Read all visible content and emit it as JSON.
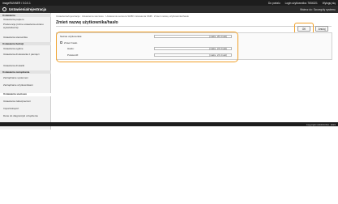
{
  "topbar": {
    "device": "imageRUNNER / 0.0.0.1",
    "links": [
      "Do portalu",
      "Login użytkownika: 7654321",
      "Wyloguj się"
    ]
  },
  "titlebar": {
    "title": "Ustawienia/rejestracja",
    "portal_link": "Wstecz do: Szczegóły systemu"
  },
  "sidebar": {
    "items": [
      {
        "label": "Ustawienia",
        "section": true
      },
      {
        "label": "Ustawienia papieru"
      },
      {
        "label": "Preferencje (różne ustawienia ekranu wyświetlacza)"
      },
      {
        "label": "Ustawienia sterownika"
      },
      {
        "label": "Ustawienia funkcji",
        "section": true
      },
      {
        "label": "Ustawienia ogólne"
      },
      {
        "label": "Ustawienia drukowania z pamięci"
      },
      {
        "label": "Ustawienia drukarki"
      },
      {
        "label": "Ustawienia zarządzania",
        "section": true
      },
      {
        "label": "Zarządzanie systemem"
      },
      {
        "label": "Zarządzanie użytkownikami"
      },
      {
        "label": "Ustawienia sieciowe",
        "active": true
      },
      {
        "label": "Ustawienia zabezpieczeń"
      },
      {
        "label": "Import/eksport"
      },
      {
        "label": "Dane do diagnostyki urządzenia"
      }
    ]
  },
  "main": {
    "breadcrumb": "Ustawienia/rejestracja : Ustawienia sieciowe : Ustawienia serwera SMB/ Ustawienia SMB : Zmień nazwę użytkownika/hasło",
    "title": "Zmień nazwę użytkownika/hasło",
    "ok_label": "OK",
    "cancel_label": "Anuluj",
    "fields": {
      "username_label": "Nazwa użytkownika:",
      "username_value": "",
      "username_hint": "(maks. 20 znaki)",
      "set_password_label": "Zmień hasło",
      "password_label": "Hasło:",
      "password_value": "",
      "password_hint": "(maks. 24 znaki)",
      "confirm_label": "Potwierdź:",
      "confirm_value": "",
      "confirm_hint": "(maks. 24 znaki)"
    }
  },
  "footer": {
    "copyright": "Copyright CANON INC. 2015"
  },
  "colors": {
    "highlight": "#f0a028",
    "topbar": "#1d1d1d"
  }
}
